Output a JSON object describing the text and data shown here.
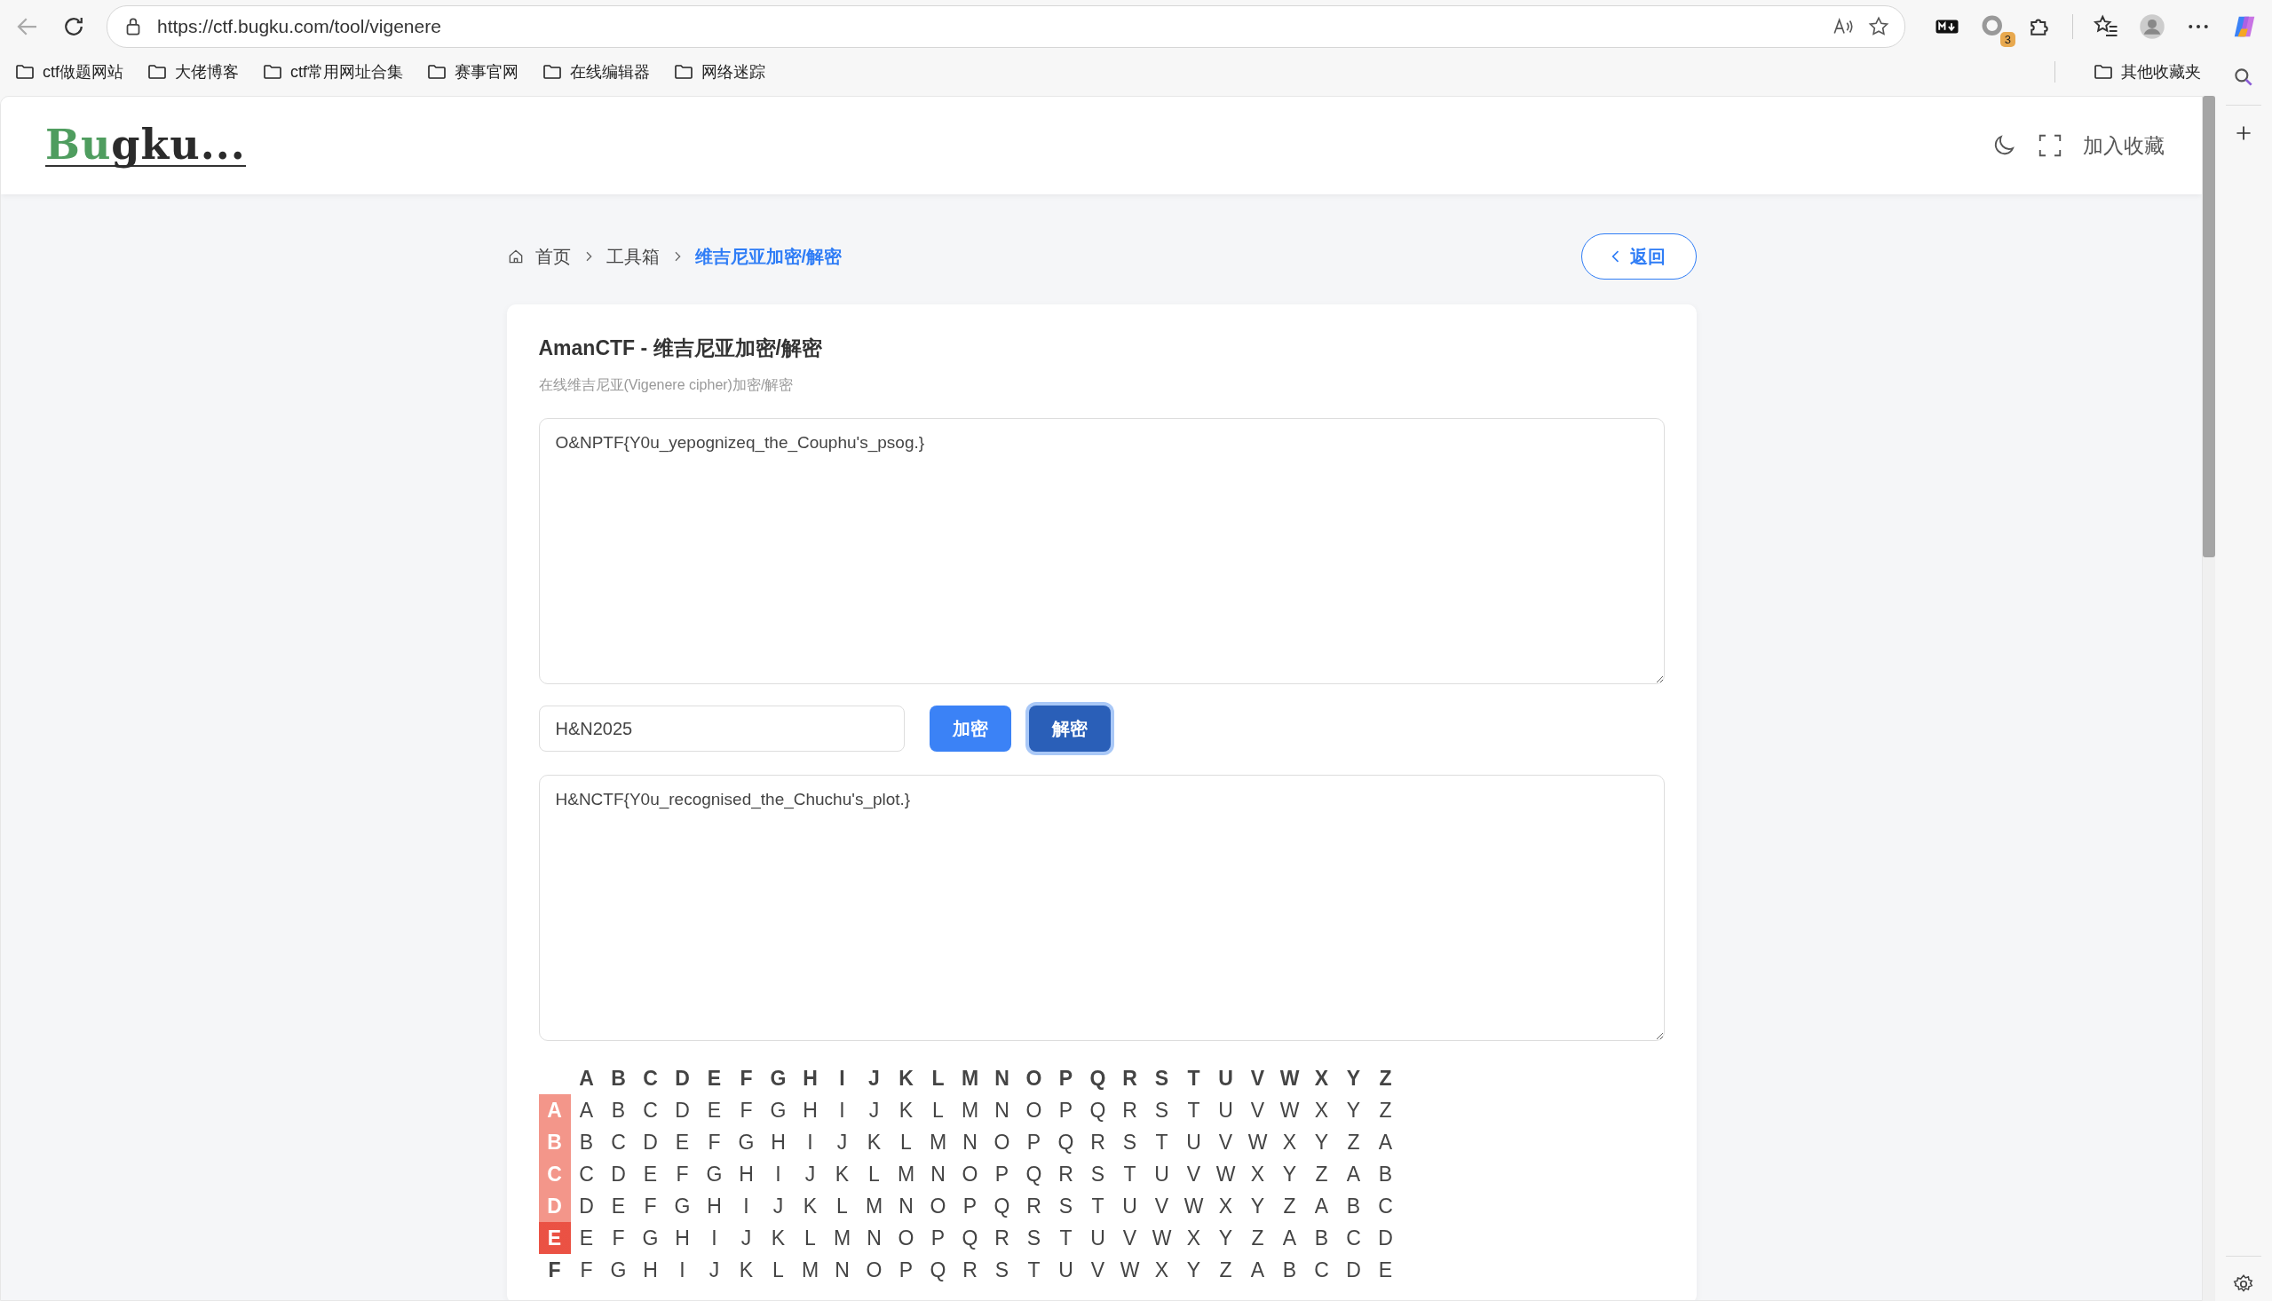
{
  "browser": {
    "url": "https://ctf.bugku.com/tool/vigenere",
    "extension_badge": "3",
    "bookmarks": [
      "ctf做题网站",
      "大佬博客",
      "ctf常用网址合集",
      "赛事官网",
      "在线编辑器",
      "网络迷踪"
    ],
    "other_bookmarks": "其他收藏夹"
  },
  "header": {
    "logo": [
      {
        "text": "Bu",
        "color": "#4f9d5f"
      },
      {
        "text": "gku...",
        "color": "#2b2b2b"
      }
    ],
    "favorite": "加入收藏"
  },
  "breadcrumb": [
    {
      "label": "首页",
      "selected": false
    },
    {
      "label": "工具箱",
      "selected": false
    },
    {
      "label": "维吉尼亚加密/解密",
      "selected": true
    }
  ],
  "back_button": "返回",
  "card": {
    "title": "AmanCTF - 维吉尼亚加密/解密",
    "subtitle": "在线维吉尼亚(Vigenere cipher)加密/解密",
    "input_text": "O&NPTF{Y0u_yepognizeq_the_Couphu's_psog.}",
    "key": "H&N2025",
    "buttons": [
      {
        "label": "加密",
        "selected": false
      },
      {
        "label": "解密",
        "selected": true
      }
    ],
    "output_text": "H&NCTF{Y0u_recognised_the_Chuchu's_plot.}"
  },
  "table": {
    "columns": [
      "A",
      "B",
      "C",
      "D",
      "E",
      "F",
      "G",
      "H",
      "I",
      "J",
      "K",
      "L",
      "M",
      "N",
      "O",
      "P",
      "Q",
      "R",
      "S",
      "T",
      "U",
      "V",
      "W",
      "X",
      "Y",
      "Z"
    ],
    "rows": [
      {
        "header": "A",
        "highlighted": true,
        "current": false,
        "cells": [
          "A",
          "B",
          "C",
          "D",
          "E",
          "F",
          "G",
          "H",
          "I",
          "J",
          "K",
          "L",
          "M",
          "N",
          "O",
          "P",
          "Q",
          "R",
          "S",
          "T",
          "U",
          "V",
          "W",
          "X",
          "Y",
          "Z"
        ]
      },
      {
        "header": "B",
        "highlighted": true,
        "current": false,
        "cells": [
          "B",
          "C",
          "D",
          "E",
          "F",
          "G",
          "H",
          "I",
          "J",
          "K",
          "L",
          "M",
          "N",
          "O",
          "P",
          "Q",
          "R",
          "S",
          "T",
          "U",
          "V",
          "W",
          "X",
          "Y",
          "Z",
          "A"
        ]
      },
      {
        "header": "C",
        "highlighted": true,
        "current": false,
        "cells": [
          "C",
          "D",
          "E",
          "F",
          "G",
          "H",
          "I",
          "J",
          "K",
          "L",
          "M",
          "N",
          "O",
          "P",
          "Q",
          "R",
          "S",
          "T",
          "U",
          "V",
          "W",
          "X",
          "Y",
          "Z",
          "A",
          "B"
        ]
      },
      {
        "header": "D",
        "highlighted": true,
        "current": false,
        "cells": [
          "D",
          "E",
          "F",
          "G",
          "H",
          "I",
          "J",
          "K",
          "L",
          "M",
          "N",
          "O",
          "P",
          "Q",
          "R",
          "S",
          "T",
          "U",
          "V",
          "W",
          "X",
          "Y",
          "Z",
          "A",
          "B",
          "C"
        ]
      },
      {
        "header": "E",
        "highlighted": true,
        "current": true,
        "cells": [
          "E",
          "F",
          "G",
          "H",
          "I",
          "J",
          "K",
          "L",
          "M",
          "N",
          "O",
          "P",
          "Q",
          "R",
          "S",
          "T",
          "U",
          "V",
          "W",
          "X",
          "Y",
          "Z",
          "A",
          "B",
          "C",
          "D"
        ]
      },
      {
        "header": "F",
        "highlighted": false,
        "current": false,
        "cells": [
          "F",
          "G",
          "H",
          "I",
          "J",
          "K",
          "L",
          "M",
          "N",
          "O",
          "P",
          "Q",
          "R",
          "S",
          "T",
          "U",
          "V",
          "W",
          "X",
          "Y",
          "Z",
          "A",
          "B",
          "C",
          "D",
          "E"
        ]
      }
    ]
  }
}
